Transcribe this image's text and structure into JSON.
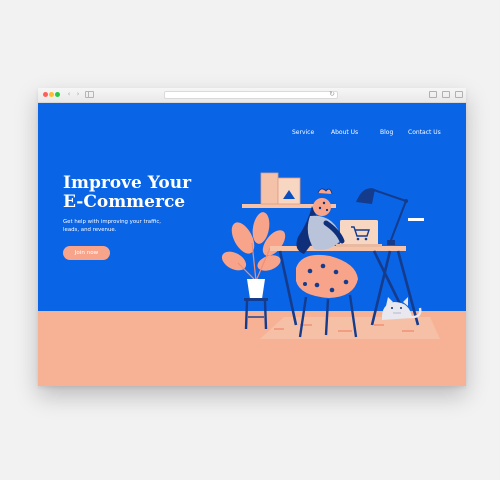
{
  "browser": {
    "back_glyph": "‹",
    "forward_glyph": "›",
    "reload_glyph": "↻"
  },
  "nav": {
    "items": [
      {
        "label": "Service"
      },
      {
        "label": "About Us"
      },
      {
        "label": "Blog"
      },
      {
        "label": "Contact Us"
      }
    ]
  },
  "hero": {
    "title_line1": "Improve Your",
    "title_line2": "E-Commerce",
    "subtitle": "Get help with improving your traffic, leads, and revenue.",
    "cta_label": "Join now"
  },
  "colors": {
    "background": "#0a64e6",
    "floor": "#f7b296",
    "accent": "#f7a48b",
    "text": "#ffffff"
  },
  "icons": [
    "shopping-cart-icon",
    "desk-lamp-icon",
    "potted-plant-icon",
    "cat-icon"
  ]
}
